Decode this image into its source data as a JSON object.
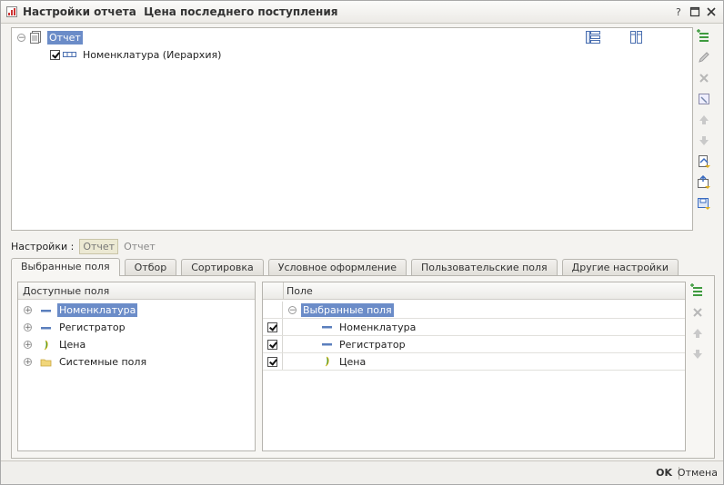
{
  "window": {
    "title_prefix": "Настройки отчета",
    "title_report": "Цена последнего поступления"
  },
  "structure": {
    "root_label": "Отчет",
    "child_label": "Номенклатура (Иерархия)"
  },
  "settings": {
    "label": "Настройки :",
    "option_active": "Отчет",
    "option_other": "Отчет"
  },
  "tabs": [
    {
      "label": "Выбранные поля",
      "active": true
    },
    {
      "label": "Отбор"
    },
    {
      "label": "Сортировка"
    },
    {
      "label": "Условное оформление"
    },
    {
      "label": "Пользовательские поля"
    },
    {
      "label": "Другие настройки"
    }
  ],
  "available_fields": {
    "header": "Доступные поля",
    "items": [
      {
        "label": "Номенклатура",
        "icon": "field-icon",
        "selected": true
      },
      {
        "label": "Регистратор",
        "icon": "field-icon"
      },
      {
        "label": "Цена",
        "icon": "resource-icon"
      },
      {
        "label": "Системные поля",
        "icon": "folder-icon"
      }
    ]
  },
  "selected_fields": {
    "header": "Поле",
    "group_label": "Выбранные поля",
    "items": [
      {
        "label": "Номенклатура",
        "checked": true,
        "icon": "field-icon"
      },
      {
        "label": "Регистратор",
        "checked": true,
        "icon": "field-icon"
      },
      {
        "label": "Цена",
        "checked": true,
        "icon": "resource-icon"
      }
    ]
  },
  "footer": {
    "ok_label": "OK",
    "cancel_label": "Отмена"
  },
  "colors": {
    "selection": "#6b8cc8",
    "toolbar_green": "#3f9b3f",
    "resource_green": "#2f8f1f"
  }
}
